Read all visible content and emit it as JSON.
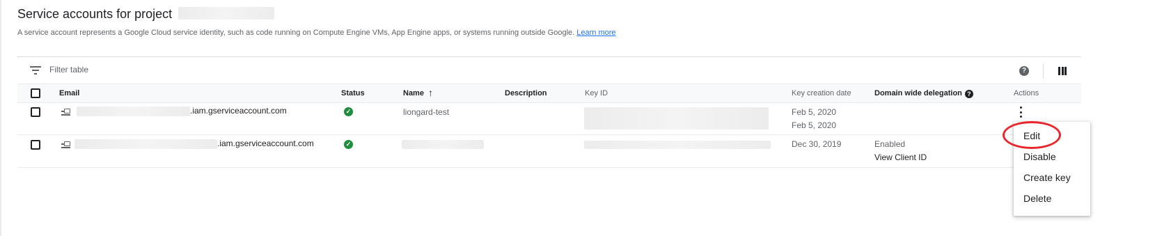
{
  "header": {
    "title": "Service accounts for project",
    "description": "A service account represents a Google Cloud service identity, such as code running on Compute Engine VMs, App Engine apps, or systems running outside Google.",
    "learn_more": "Learn more"
  },
  "toolbar": {
    "filter_placeholder": "Filter table",
    "help_icon": "help-icon",
    "columns_icon": "column-display-icon"
  },
  "table": {
    "columns": {
      "email": "Email",
      "status": "Status",
      "name": "Name",
      "description": "Description",
      "key_id": "Key ID",
      "key_creation_date": "Key creation date",
      "domain_wide_delegation": "Domain wide delegation",
      "actions": "Actions"
    },
    "sort": {
      "column": "Name",
      "direction": "ascending"
    },
    "rows": [
      {
        "email_suffix": ".iam.gserviceaccount.com",
        "status_icon": "check-circle-icon",
        "name": "liongard-test",
        "key_dates": [
          "Feb 5, 2020",
          "Feb 5, 2020"
        ],
        "delegation": "",
        "delegation_link": ""
      },
      {
        "email_suffix": ".iam.gserviceaccount.com",
        "status_icon": "check-circle-icon",
        "name": "",
        "key_dates": [
          "Dec 30, 2019"
        ],
        "delegation": "Enabled",
        "delegation_link": "View Client ID"
      }
    ]
  },
  "menu": {
    "items": [
      "Edit",
      "Disable",
      "Create key",
      "Delete"
    ]
  },
  "colors": {
    "accent": "#1a73e8",
    "status_ok": "#1e8e3e",
    "highlight": "#e8262b"
  }
}
